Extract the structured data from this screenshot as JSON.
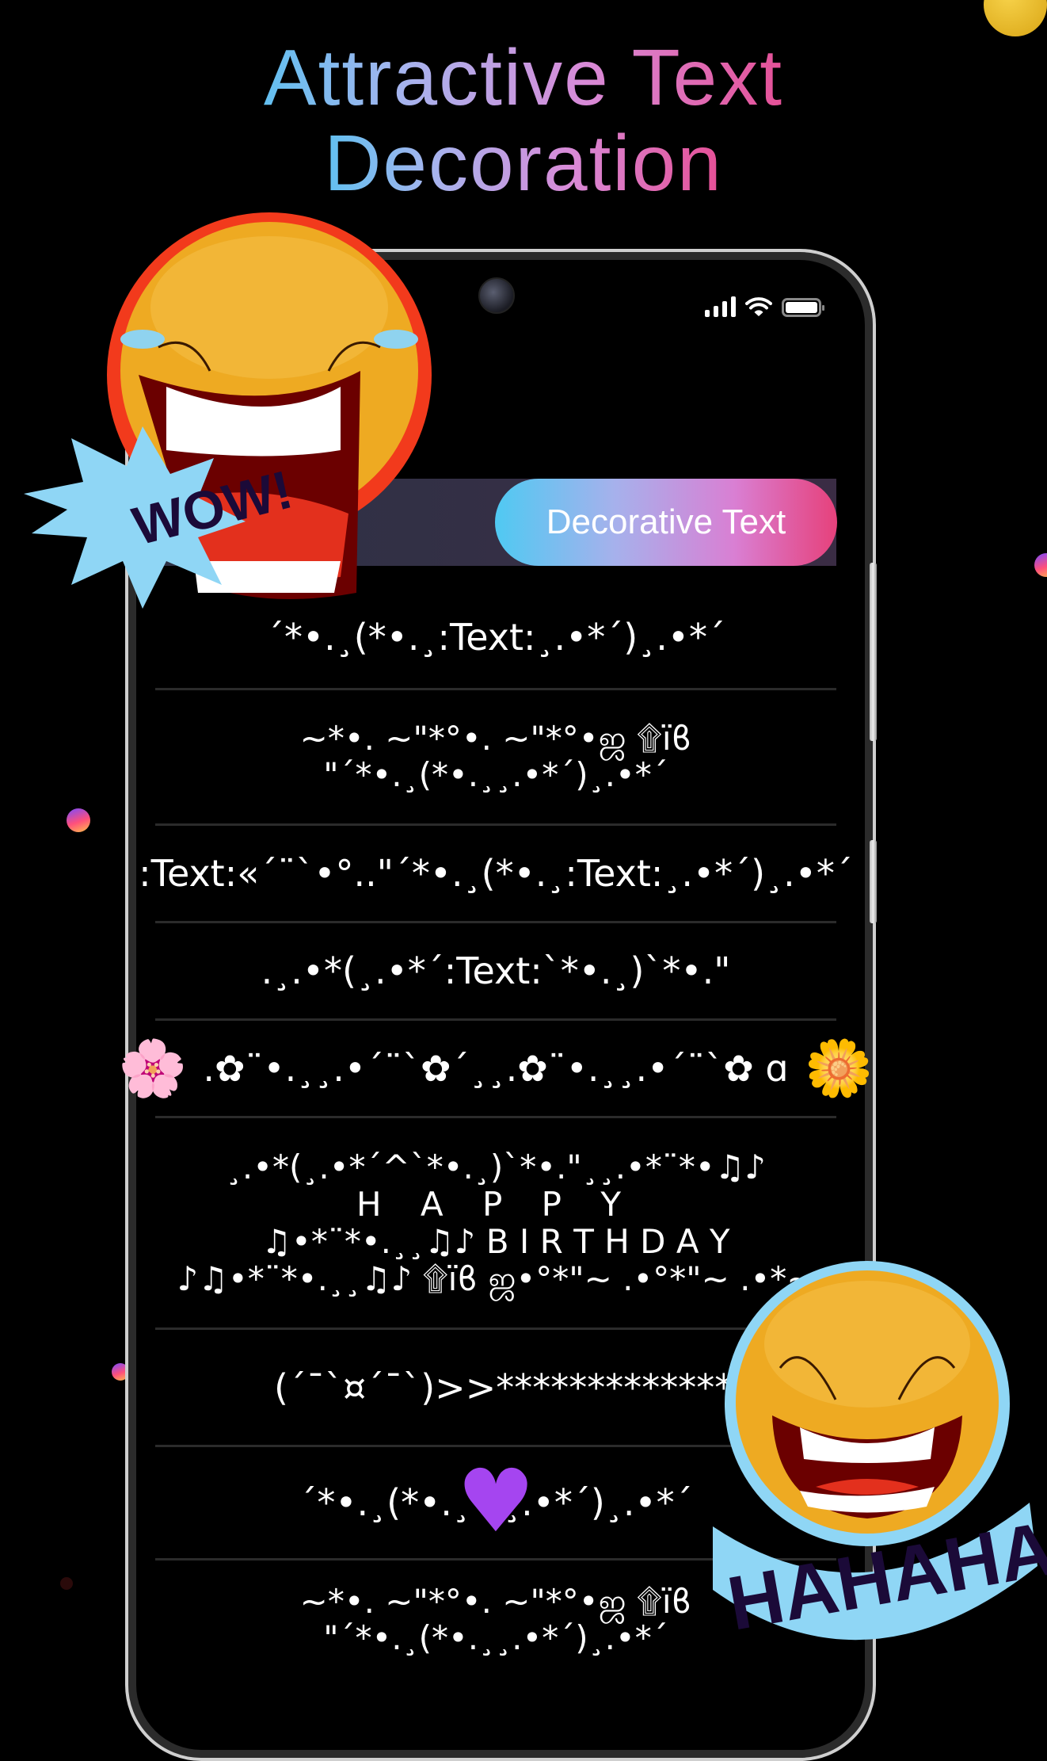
{
  "headline": {
    "line1": "Attractive Text",
    "line2": "Decoration",
    "gradient": [
      "#4fc3f0",
      "#a6b4ee",
      "#d88bd8",
      "#e8458a"
    ]
  },
  "status_bar": {
    "signal_icon": "cellular-signal-icon",
    "wifi_icon": "wifi-icon",
    "battery_icon": "battery-icon"
  },
  "tabs": [
    {
      "label": "",
      "active": false
    },
    {
      "label": "Decorative Text",
      "active": true
    }
  ],
  "decorated_items": [
    {
      "lines": [
        "´*•.¸(*•.¸:Text:¸.•*´)¸.•*´"
      ]
    },
    {
      "lines": [
        "~*•. ~\"*°•. ~\"*°•ஜ ۩ïϐ",
        "\"´*•.¸(*•.¸¸.•*´)¸.•*´"
      ]
    },
    {
      "lines": [
        ":Text:«´¨`•°..\"´*•.¸(*•.¸:Text:¸.•*´)¸.•*´"
      ]
    },
    {
      "lines": [
        ".¸.•*(¸.•*´:Text:`*•.¸)`*•.\""
      ]
    },
    {
      "lines": [
        ".✿¨•.¸¸.•´¨`✿´¸¸.✿¨•.¸¸.•´¨`✿ ɑ"
      ],
      "emoji_left": "🌸",
      "emoji_right": "🌼"
    },
    {
      "lines": [
        "¸.•*(¸.•*´^`*•.¸)`*•.\"¸¸.•*¨*•♫♪",
        "H A P P Y",
        "♫•*¨*•.¸¸♫♪ B I R T H D A Y",
        "♪♫•*¨*•.¸¸♫♪ ۩ïϐ ஜ•°*\"~ .•°*\"~ .•*~"
      ]
    },
    {
      "lines": [
        "(´¯`¤´¯`)>>*******************"
      ]
    },
    {
      "lines": [
        "´*•.¸(*•.¸♥¸.•*´)¸.•*´"
      ],
      "emoji_center": "💜"
    },
    {
      "lines": [
        "~*•. ~\"*°•. ~\"*°•ஜ ۩ïϐ",
        "\"´*•.¸(*•.¸¸.•*´)¸.•*´"
      ]
    }
  ],
  "stickers": {
    "wow": {
      "text": "WOW!",
      "face": "laughing-tears-emoji"
    },
    "haha": {
      "text": "HAHAHA",
      "face": "laughing-emoji"
    }
  }
}
